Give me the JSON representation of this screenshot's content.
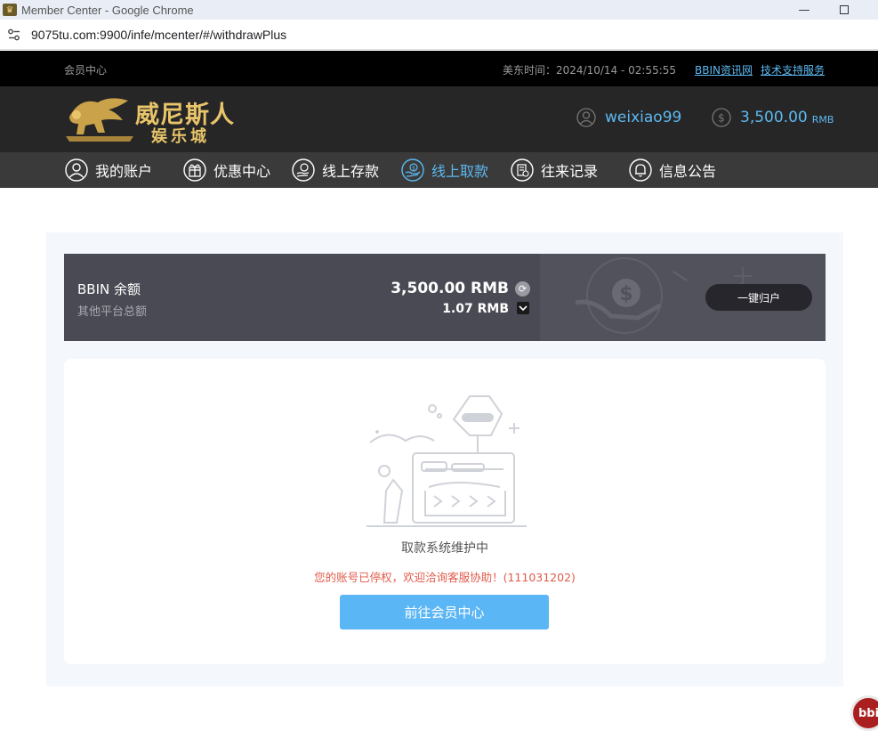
{
  "browser": {
    "window_title": "Member Center - Google Chrome",
    "url": "9075tu.com:9900/infe/mcenter/#/withdrawPlus"
  },
  "topbar": {
    "member_center": "会员中心",
    "time_label": "美东时间：2024/10/14 - 02:55:55",
    "link_news": "BBIN资讯网",
    "link_support": "技术支持服务"
  },
  "header": {
    "logo_text_1": "威尼斯人",
    "logo_text_2": "娱乐城",
    "username": "weixiao99",
    "balance": "3,500.00",
    "currency": "RMB"
  },
  "nav": {
    "items": [
      {
        "label": "我的账户",
        "icon": "user-icon"
      },
      {
        "label": "优惠中心",
        "icon": "gift-icon"
      },
      {
        "label": "线上存款",
        "icon": "deposit-icon"
      },
      {
        "label": "线上取款",
        "icon": "withdraw-icon"
      },
      {
        "label": "往来记录",
        "icon": "record-icon"
      },
      {
        "label": "信息公告",
        "icon": "bell-icon"
      }
    ],
    "active_index": 3
  },
  "balance_bar": {
    "title": "BBIN 余额",
    "subtitle": "其他平台总额",
    "main_value": "3,500.00 RMB",
    "other_value": "1.07 RMB",
    "collect_button": "一键归户"
  },
  "notice": {
    "status": "取款系统维护中",
    "error": "您的账号已停权，欢迎洽询客服协助！(111031202)",
    "button": "前往会员中心"
  },
  "float_badge": "bbin",
  "colors": {
    "accent": "#5db8f0",
    "error": "#e05a4a",
    "button": "#5bb6f5"
  }
}
